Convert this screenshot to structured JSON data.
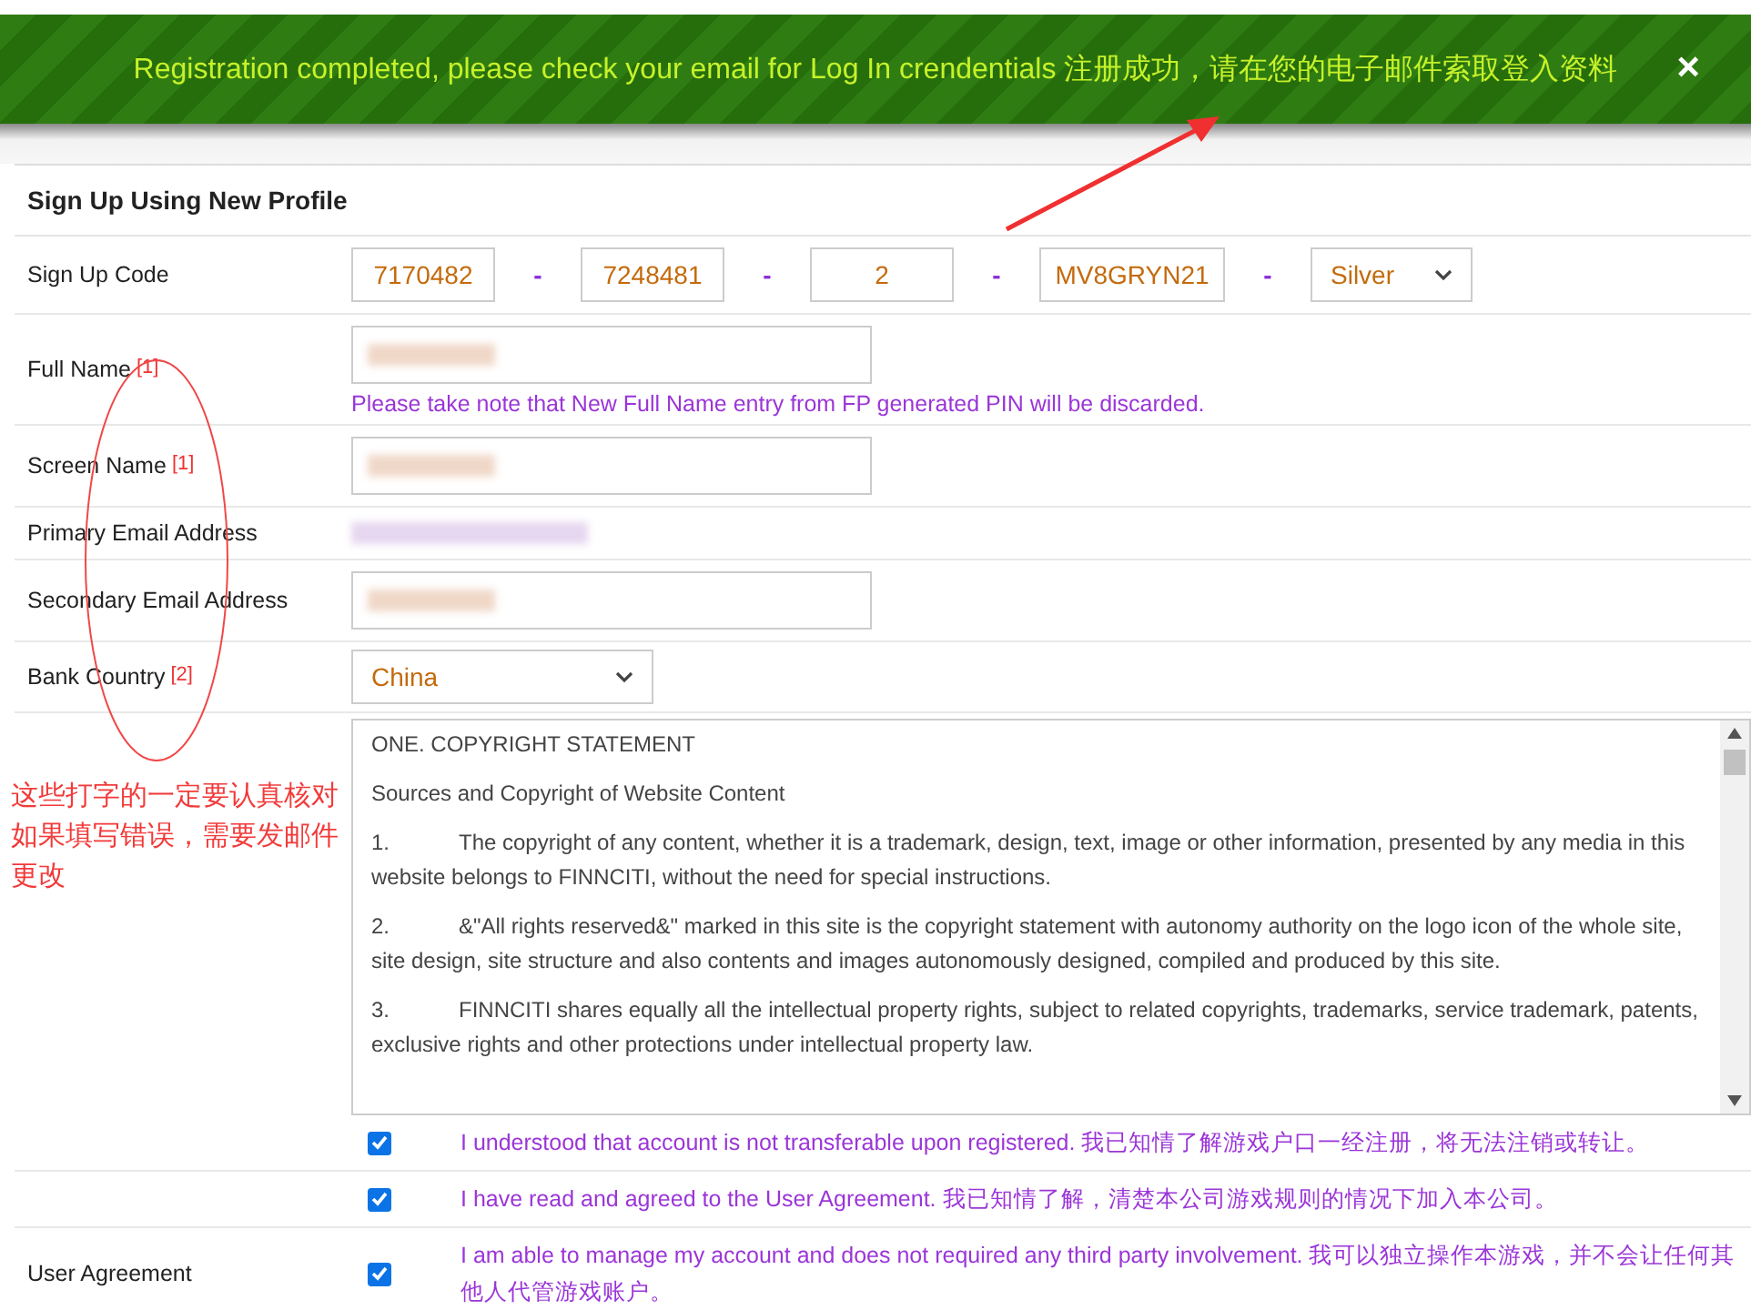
{
  "banner": {
    "message": "Registration completed, please check your email for Log In crendentials 注册成功，请在您的电子邮件索取登入资料",
    "close": "×"
  },
  "form": {
    "title": "Sign Up Using New Profile",
    "rows": [
      {
        "kind": "code",
        "label": "Sign Up Code",
        "parts": [
          "7170482",
          "7248481",
          "2",
          "MV8GRYN21"
        ],
        "separator": "-",
        "tier": "Silver"
      },
      {
        "kind": "text",
        "label": "Full Name",
        "note_mark": "[1]",
        "hint": "Please take note that New Full Name entry from FP generated PIN will be discarded."
      },
      {
        "kind": "text",
        "label": "Screen Name",
        "note_mark": "[1]"
      },
      {
        "kind": "plain",
        "label": "Primary Email Address"
      },
      {
        "kind": "text",
        "label": "Secondary Email Address"
      },
      {
        "kind": "select",
        "label": "Bank Country",
        "note_mark": "[2]",
        "value": "China"
      },
      {
        "kind": "terms",
        "paragraphs": [
          "ONE. COPYRIGHT STATEMENT",
          "Sources and Copyright of Website Content",
          "1.\tThe copyright of any content, whether it is a trademark, design, text, image or other information, presented by any media in this website belongs to FINNCITI, without the need for special instructions.",
          "2.\t&\"All rights reserved&\" marked in this site is the copyright statement with autonomy authority on the logo icon of the whole site, site design, site structure and also contents and images autonomously designed, compiled and produced by this site.",
          "3.\tFINNCITI shares equally all the intellectual property rights, subject to related copyrights, trademarks, service trademark, patents, exclusive rights and other protections under intellectual property law."
        ]
      },
      {
        "kind": "check",
        "checked": true,
        "text": "I understood that account is not transferable upon registered. 我已知情了解游戏户口一经注册，将无法注销或转让。"
      },
      {
        "kind": "check",
        "checked": true,
        "text": "I have read and agreed to the User Agreement. 我已知情了解，清楚本公司游戏规则的情况下加入本公司。"
      },
      {
        "kind": "check",
        "label": "User Agreement",
        "checked": true,
        "text": "I am able to manage my account and does not required any third party involvement. 我可以独立操作本游戏，并不会让任何其他人代管游戏账户。"
      }
    ]
  },
  "annotation": {
    "note_lines": [
      "这些打字的一定要认真核对",
      "如果填写错误，需要发邮件",
      "更改"
    ]
  }
}
